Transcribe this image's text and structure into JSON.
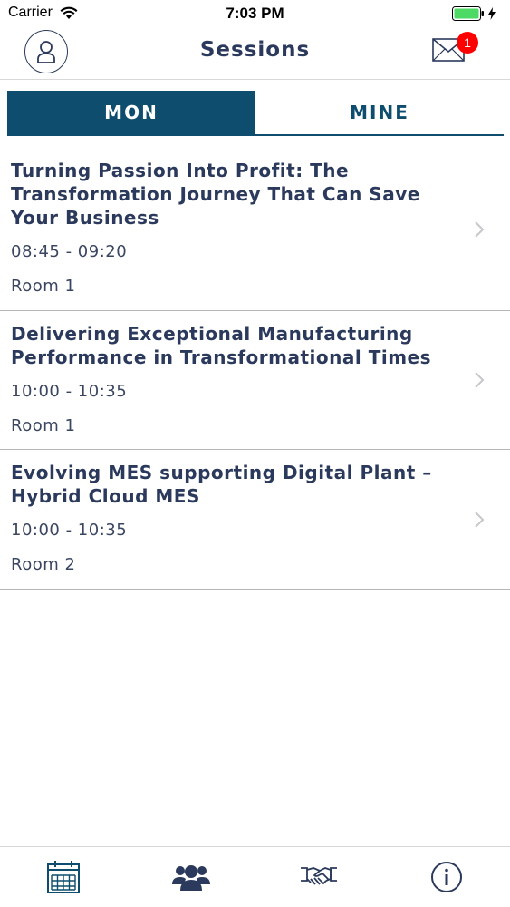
{
  "status_bar": {
    "carrier": "Carrier",
    "time": "7:03 PM",
    "battery_color": "#4cd964"
  },
  "nav": {
    "title": "Sessions",
    "mail_badge": "1",
    "badge_color": "#ff0000"
  },
  "tabs": [
    {
      "label": "MON",
      "active": true
    },
    {
      "label": "MINE",
      "active": false
    }
  ],
  "sessions": [
    {
      "title": "Turning Passion Into Profit: The Transformation Journey That Can Save Your Business",
      "time": "08:45 - 09:20",
      "room": "Room 1"
    },
    {
      "title": "Delivering Exceptional Manufacturing Performance in Transformational Times",
      "time": "10:00 - 10:35",
      "room": "Room 1"
    },
    {
      "title": "Evolving MES supporting Digital Plant – Hybrid Cloud MES",
      "time": "10:00 - 10:35",
      "room": "Room 2"
    }
  ],
  "tab_bar": [
    {
      "icon": "calendar-icon"
    },
    {
      "icon": "people-icon"
    },
    {
      "icon": "handshake-icon"
    },
    {
      "icon": "info-icon"
    }
  ],
  "colors": {
    "primary": "#0e4d6e",
    "text": "#2b3a5c"
  }
}
